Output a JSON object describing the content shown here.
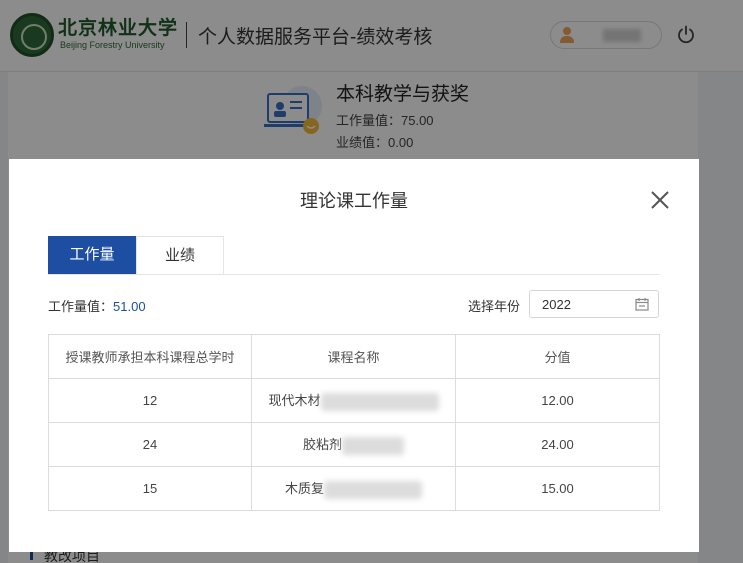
{
  "header": {
    "logo_cn": "北京林业大学",
    "logo_en": "Beijing Forestry University",
    "platform_title": "个人数据服务平台-绩效考核",
    "icons": {
      "user": "user-icon",
      "power": "power-icon"
    }
  },
  "background": {
    "card_title": "本科教学与获奖",
    "workload_label": "工作量值：75.00",
    "performance_label": "业绩值：0.00",
    "section_title": "教改项目"
  },
  "modal": {
    "title": "理论课工作量",
    "tabs": [
      {
        "label": "工作量",
        "active": true
      },
      {
        "label": "业绩",
        "active": false
      }
    ],
    "summary_label": "工作量值：",
    "summary_value": "51.00",
    "year_label": "选择年份",
    "year_value": "2022",
    "table": {
      "headers": [
        "授课教师承担本科课程总学时",
        "课程名称",
        "分值"
      ],
      "rows": [
        {
          "hours": "12",
          "course": "现代木材",
          "score": "12.00"
        },
        {
          "hours": "24",
          "course": "胶粘剂",
          "score": "24.00"
        },
        {
          "hours": "15",
          "course": "木质复",
          "score": "15.00"
        }
      ]
    }
  },
  "colors": {
    "accent": "#1d4ea2",
    "logo_green": "#1f5a2d",
    "overlay": "rgba(0,0,0,0.45)"
  }
}
